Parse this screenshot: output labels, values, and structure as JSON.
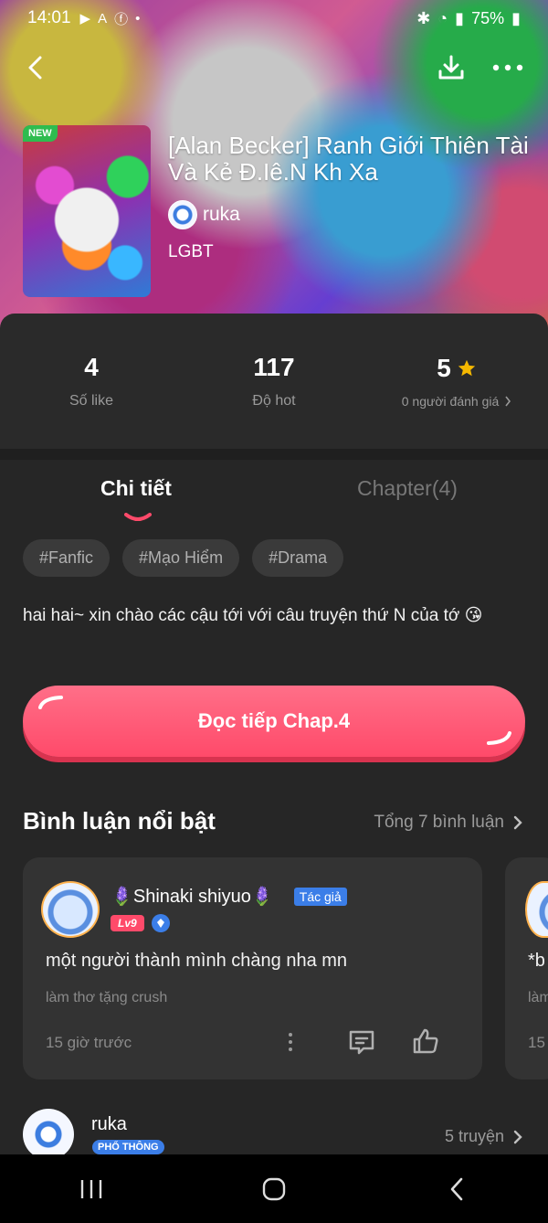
{
  "status": {
    "time": "14:01",
    "battery": "75%"
  },
  "book": {
    "cover_badge": "NEW",
    "title": "[Alan Becker] Ranh Giới Thiên Tài Và Kẻ Đ.Iê.N Kh Xa",
    "author": "ruka",
    "genre": "LGBT"
  },
  "stats": {
    "likes_value": "4",
    "likes_label": "Số like",
    "hot_value": "117",
    "hot_label": "Độ hot",
    "rating_value": "5",
    "rating_label": "0 người đánh giá"
  },
  "tabs": {
    "detail": "Chi tiết",
    "chapters": "Chapter(4)"
  },
  "tags": [
    "#Fanfic",
    "#Mạo Hiểm",
    "#Drama"
  ],
  "description": "hai hai~ xin chào các cậu tới với câu truyện thứ N của tớ 😘",
  "read_button": "Đọc tiếp Chap.4",
  "comments": {
    "section_title": "Bình luận nổi bật",
    "total_link": "Tổng 7 bình luận",
    "featured": {
      "user": "🪻Shinaki shiyuo🪻",
      "author_badge": "Tác giả",
      "level": "Lv9",
      "text": "một người thành mình chàng nha mn",
      "subtext": "làm thơ tặng crush",
      "time": "15 giờ trước"
    },
    "peek": {
      "text": "*b",
      "subtext": "làm",
      "time": "15"
    }
  },
  "author_card": {
    "name": "ruka",
    "badge": "PHỔ THÔNG",
    "stories": "5 truyện"
  },
  "colors": {
    "accent_pink": "#ff4a6a",
    "panel_bg": "#2a2a2a",
    "badge_blue": "#3b7ee8",
    "star": "#f5b800"
  }
}
